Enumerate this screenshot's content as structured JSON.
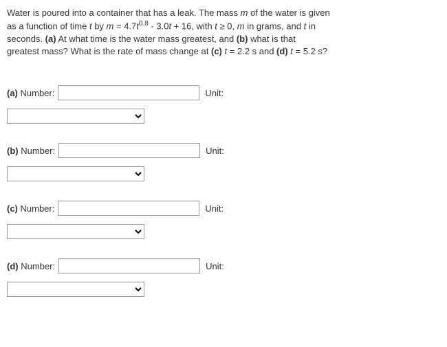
{
  "problem": {
    "line1_pre": "Water is poured into a container that has a leak. The mass ",
    "m_var": "m",
    "line1_post": " of the water is given",
    "line2_pre": "as a function of time ",
    "t_var": "t",
    "line2_by": " by ",
    "line2_eq_lhs": "m",
    "line2_eq": " = 4.7",
    "line2_t": "t",
    "line2_exp": "0.8",
    "line2_post": " - 3.0",
    "line2_t2": "t",
    "line2_post2": " + 16, with ",
    "line2_t3": "t",
    "line2_post3": " ≥ 0, ",
    "line2_m2": "m",
    "line2_post4": " in grams, and ",
    "line2_t4": "t",
    "line2_post5": " in",
    "line3_pre": "seconds. ",
    "part_a": "(a)",
    "line3_mid": " At what time is the water mass greatest, and ",
    "part_b": "(b)",
    "line3_post": " what is that",
    "line4_pre": "greatest mass? What is the rate of mass change at ",
    "part_c": "(c)",
    "line4_mid": " ",
    "line4_t": "t",
    "line4_mid2": " = 2.2 s and ",
    "part_d": "(d)",
    "line4_post": " ",
    "line4_t2": "t",
    "line4_post2": " = 5.2 s?"
  },
  "parts": {
    "a": {
      "label": "(a)",
      "number_label": " Number: ",
      "unit_label": "Unit:"
    },
    "b": {
      "label": "(b)",
      "number_label": " Number: ",
      "unit_label": "Unit:"
    },
    "c": {
      "label": "(c)",
      "number_label": " Number: ",
      "unit_label": "Unit:"
    },
    "d": {
      "label": "(d)",
      "number_label": " Number: ",
      "unit_label": "Unit:"
    }
  }
}
